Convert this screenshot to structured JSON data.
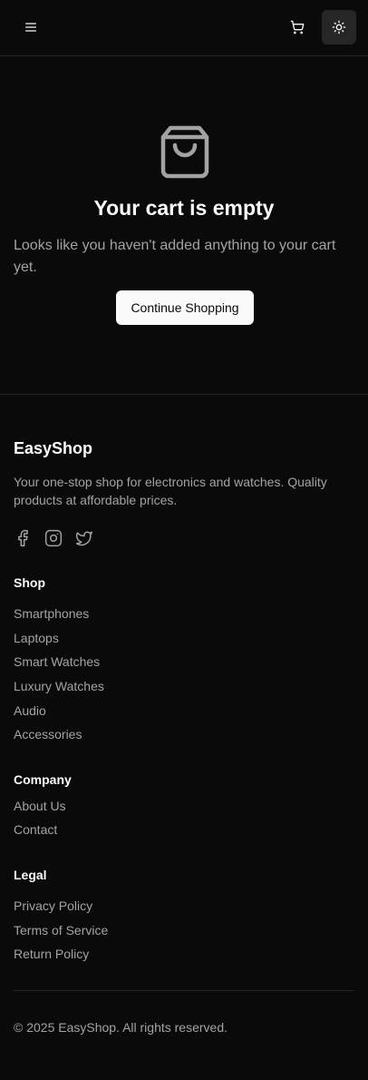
{
  "header": {
    "menu_icon": "menu-icon",
    "cart_icon": "shopping-cart-icon",
    "theme_icon": "sun-icon"
  },
  "cart": {
    "icon": "shopping-bag-icon",
    "title": "Your cart is empty",
    "description": "Looks like you haven't added anything to your cart yet.",
    "continue_label": "Continue Shopping"
  },
  "footer": {
    "brand": "EasyShop",
    "tagline": "Your one-stop shop for electronics and watches. Quality products at affordable prices.",
    "social": [
      "facebook-icon",
      "instagram-icon",
      "twitter-icon"
    ],
    "shop": {
      "title": "Shop",
      "links": [
        "Smartphones",
        "Laptops",
        "Smart Watches",
        "Luxury Watches",
        "Audio",
        "Accessories"
      ]
    },
    "company": {
      "title": "Company",
      "links": [
        "About Us",
        "Contact"
      ]
    },
    "legal": {
      "title": "Legal",
      "links": [
        "Privacy Policy",
        "Terms of Service",
        "Return Policy"
      ]
    },
    "copyright": "© 2025 EasyShop. All rights reserved."
  },
  "colors": {
    "background": "#0a0a0a",
    "text": "#fafafa",
    "muted": "#a3a3a3",
    "border": "#262626"
  }
}
